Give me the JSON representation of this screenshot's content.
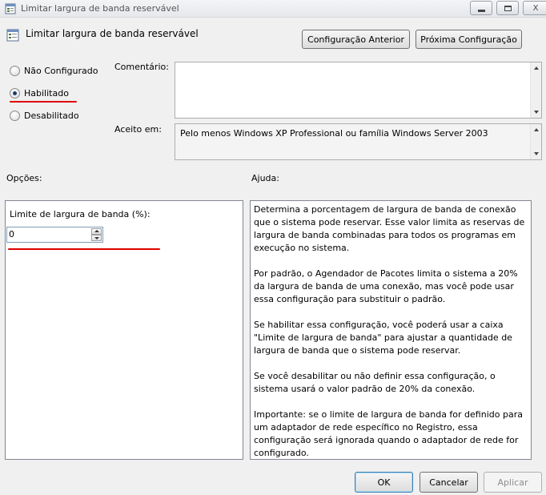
{
  "window": {
    "title": "Limitar largura de banda reservável",
    "close_symbol": "X"
  },
  "header": {
    "title": "Limitar largura de banda reservável",
    "prev_button": "Configuração Anterior",
    "next_button": "Próxima Configuração"
  },
  "state": {
    "options": [
      {
        "label": "Não Configurado",
        "selected": false
      },
      {
        "label": "Habilitado",
        "selected": true
      },
      {
        "label": "Desabilitado",
        "selected": false
      }
    ]
  },
  "comment": {
    "label": "Comentário:",
    "value": ""
  },
  "supported": {
    "label": "Aceito em:",
    "value": "Pelo menos Windows XP Professional ou família Windows Server 2003"
  },
  "options_section": {
    "label": "Opções:",
    "bandwidth_label": "Limite de largura de banda (%):",
    "bandwidth_value": "0"
  },
  "help_section": {
    "label": "Ajuda:",
    "paragraphs": [
      "Determina a porcentagem de largura de banda de conexão que o sistema pode reservar. Esse valor limita as reservas de largura de banda combinadas para todos os programas em execução no sistema.",
      "Por padrão, o Agendador de Pacotes limita o sistema a 20% da largura de banda de uma conexão, mas você pode usar essa configuração para substituir o padrão.",
      "Se habilitar essa configuração, você poderá usar a caixa \"Limite de largura de banda\" para ajustar a quantidade de largura de banda que o sistema pode reservar.",
      "Se você desabilitar ou não definir essa configuração, o sistema usará o valor padrão de 20% da conexão.",
      "Importante: se o limite de largura de banda for definido para um adaptador de rede específico no Registro, essa configuração será ignorada quando o adaptador de rede for configurado."
    ]
  },
  "footer": {
    "ok": "OK",
    "cancel": "Cancelar",
    "apply": "Aplicar"
  },
  "colors": {
    "annotation_red": "#e00000",
    "window_bg": "#f0f0f0"
  }
}
